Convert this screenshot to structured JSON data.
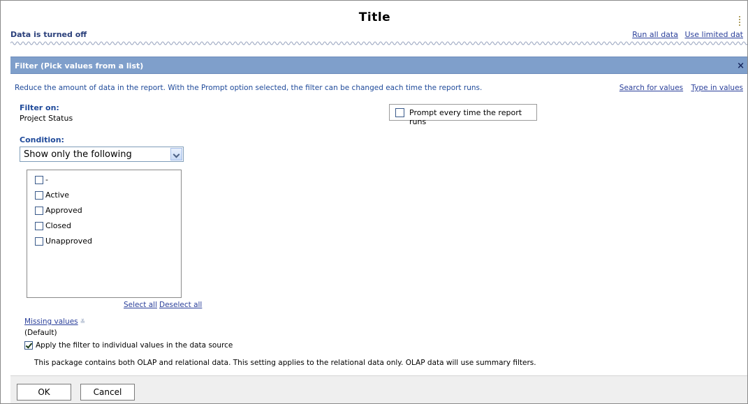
{
  "header": {
    "title": "Title",
    "data_status": "Data is turned off",
    "links": [
      "Run all data",
      "Use limited dat"
    ]
  },
  "filter_panel": {
    "title": "Filter (Pick values from a list)",
    "close_glyph": "×",
    "description": "Reduce the amount of data in the report. With the Prompt option selected, the filter can be changed each time the report runs.",
    "links": [
      "Search for values",
      "Type in values"
    ],
    "filter_on_label": "Filter on:",
    "filter_on_value": "Project Status",
    "prompt_label": "Prompt every time the report runs",
    "prompt_checked": false,
    "condition_label": "Condition:",
    "condition_value": "Show only the following",
    "values": [
      {
        "label": "-",
        "checked": false
      },
      {
        "label": "Active",
        "checked": false
      },
      {
        "label": "Approved",
        "checked": false
      },
      {
        "label": "Closed",
        "checked": false
      },
      {
        "label": "Unapproved",
        "checked": false
      }
    ],
    "select_all": "Select all",
    "deselect_all": "Deselect all",
    "missing_values_label": "Missing values",
    "missing_values_chevron": "≚",
    "missing_values_value": "(Default)",
    "apply_label": "Apply the filter to individual values in the data source",
    "apply_checked": true,
    "apply_note": "This package contains both OLAP and relational data. This setting applies to the relational data only. OLAP data will use summary filters."
  },
  "footer": {
    "ok_label": "OK",
    "cancel_label": "Cancel"
  }
}
